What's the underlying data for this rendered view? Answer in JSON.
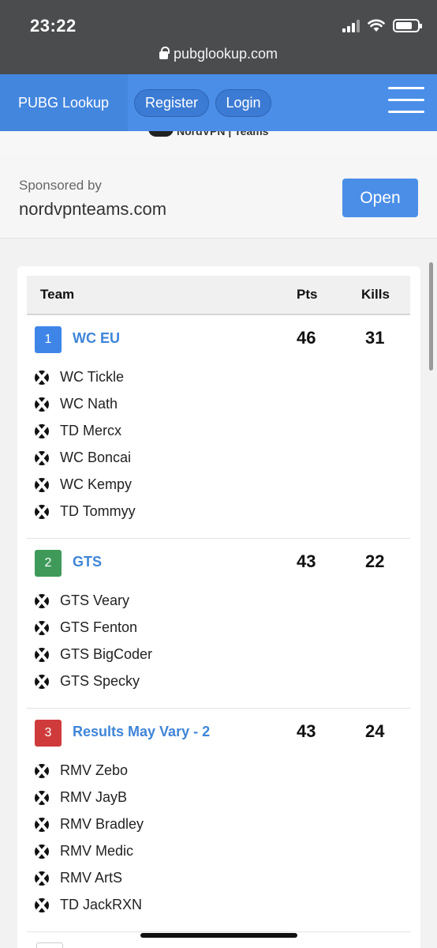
{
  "status_bar": {
    "time": "23:22"
  },
  "browser": {
    "url": "pubglookup.com"
  },
  "navbar": {
    "brand": "PUBG Lookup",
    "register": "Register",
    "login": "Login"
  },
  "ad": {
    "banner_text": "NordVPN | Teams",
    "sponsored_by": "Sponsored by",
    "domain": "nordvpnteams.com",
    "open": "Open"
  },
  "table": {
    "headers": {
      "team": "Team",
      "pts": "Pts",
      "kills": "Kills"
    },
    "teams": [
      {
        "rank": "1",
        "rank_color": "#3f85e8",
        "name": "WC EU",
        "pts": "46",
        "kills": "31",
        "players": [
          "WC Tickle",
          "WC Nath",
          "TD Mercx",
          "WC Boncai",
          "WC Kempy",
          "TD Tommyy"
        ]
      },
      {
        "rank": "2",
        "rank_color": "#3f9a5a",
        "name": "GTS",
        "pts": "43",
        "kills": "22",
        "players": [
          "GTS Veary",
          "GTS Fenton",
          "GTS BigCoder",
          "GTS Specky"
        ]
      },
      {
        "rank": "3",
        "rank_color": "#cf3b3b",
        "name": "Results May Vary - 2",
        "pts": "43",
        "kills": "24",
        "players": [
          "RMV Zebo",
          "RMV JayB",
          "RMV Bradley",
          "RMV Medic",
          "RMV ArtS",
          "TD JackRXN"
        ]
      }
    ]
  },
  "colors": {
    "accent": "#4a8ee8",
    "chrome": "#4b4c4e",
    "link": "#3f85d8"
  }
}
